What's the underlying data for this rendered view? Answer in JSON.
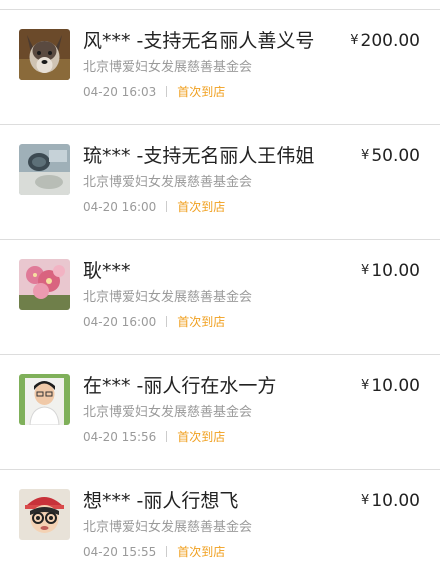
{
  "currency_symbol": "¥",
  "items": [
    {
      "title": "风*** -支持无名丽人善义号",
      "amount": "200.00",
      "org": "北京博爱妇女发展慈善基金会",
      "time": "04-20 16:03",
      "badge": "首次到店",
      "avatar_icon": "wolf-dog-photo"
    },
    {
      "title": "琉*** -支持无名丽人王伟姐",
      "amount": "50.00",
      "org": "北京博爱妇女发展慈善基金会",
      "time": "04-20 16:00",
      "badge": "首次到店",
      "avatar_icon": "pet-photo"
    },
    {
      "title": "耿***",
      "amount": "10.00",
      "org": "北京博爱妇女发展慈善基金会",
      "time": "04-20 16:00",
      "badge": "首次到店",
      "avatar_icon": "pink-flower-photo"
    },
    {
      "title": "在*** -丽人行在水一方",
      "amount": "10.00",
      "org": "北京博爱妇女发展慈善基金会",
      "time": "04-20 15:56",
      "badge": "首次到店",
      "avatar_icon": "boy-portrait-photo"
    },
    {
      "title": "想*** -丽人行想飞",
      "amount": "10.00",
      "org": "北京博爱妇女发展慈善基金会",
      "time": "04-20 15:55",
      "badge": "首次到店",
      "avatar_icon": "child-with-glasses-photo"
    }
  ],
  "colors": {
    "badge": "#f0a020",
    "secondary_text": "#9a9a9a",
    "primary_text": "#222222",
    "divider": "#dddddd"
  }
}
